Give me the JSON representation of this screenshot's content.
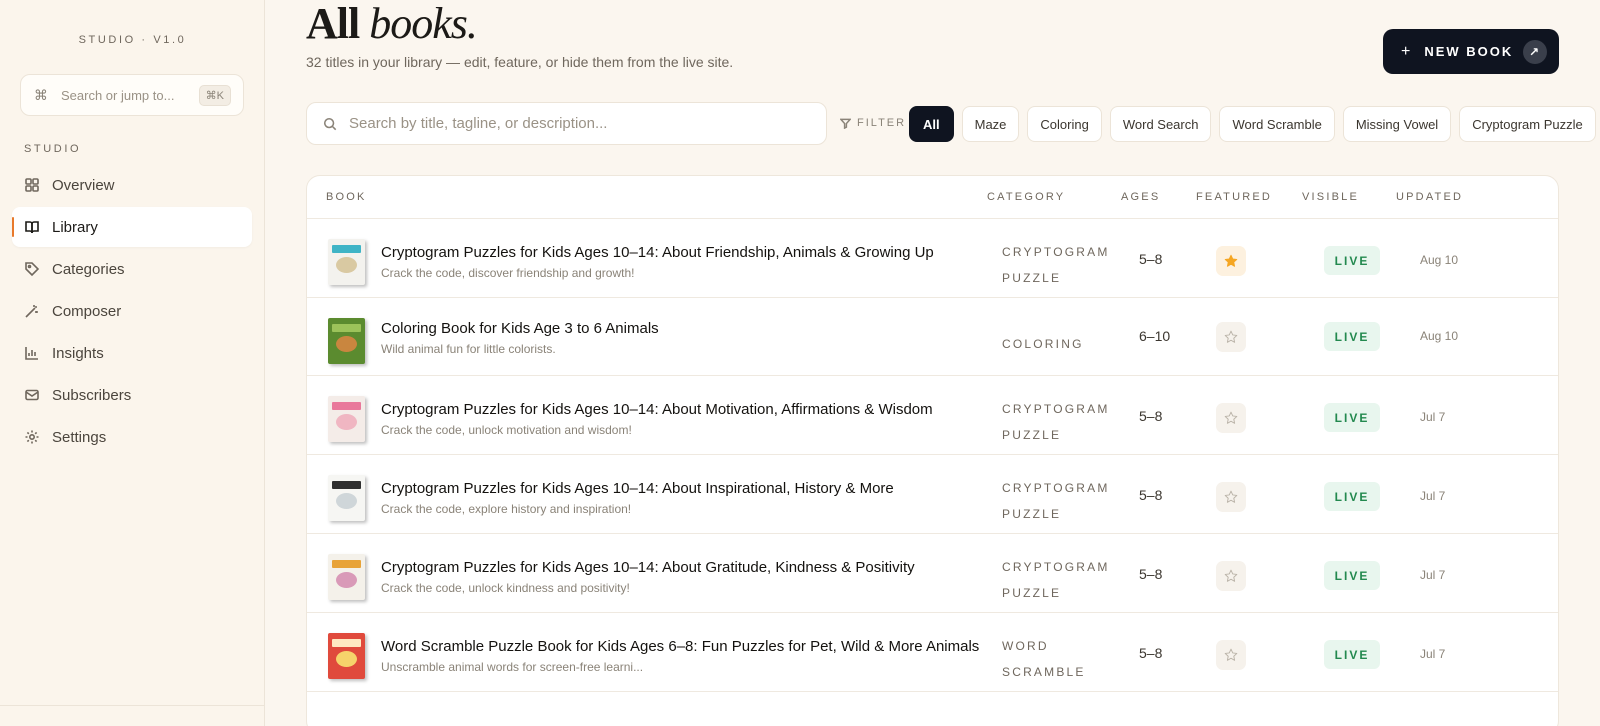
{
  "sidebar": {
    "brand": "STUDIO · V1.0",
    "jump": {
      "placeholder": "Search or jump to...",
      "shortcut": "⌘K",
      "icon": "command-icon"
    },
    "section_label": "STUDIO",
    "items": [
      {
        "label": "Overview",
        "icon": "grid-icon"
      },
      {
        "label": "Library",
        "icon": "open-book-icon",
        "active": true
      },
      {
        "label": "Categories",
        "icon": "tag-icon"
      },
      {
        "label": "Composer",
        "icon": "magic-wand-icon"
      },
      {
        "label": "Insights",
        "icon": "bar-chart-icon"
      },
      {
        "label": "Subscribers",
        "icon": "mail-icon"
      },
      {
        "label": "Settings",
        "icon": "gear-icon"
      }
    ],
    "accent": "#e8792b"
  },
  "header": {
    "title_bold": "All",
    "title_italic": "books.",
    "subtitle": "32 titles in your library — edit, feature, or hide them from the live site.",
    "new_button": "NEW BOOK"
  },
  "search": {
    "placeholder": "Search by title, tagline, or description...",
    "value": ""
  },
  "filter": {
    "label": "FILTER",
    "chips": [
      "All",
      "Maze",
      "Coloring",
      "Word Search",
      "Word Scramble",
      "Missing Vowel",
      "Cryptogram Puzzle"
    ],
    "active": "All"
  },
  "table": {
    "columns": {
      "book": "BOOK",
      "category": "CATEGORY",
      "ages": "AGES",
      "featured": "FEATURED",
      "visible": "VISIBLE",
      "updated": "UPDATED"
    },
    "rows": [
      {
        "title": "Cryptogram Puzzles for Kids Ages 10–14: About Friendship, Animals & Growing Up",
        "tagline": "Crack the code, discover friendship and growth!",
        "cat1": "CRYPTOGRAM",
        "cat2": "PUZZLE",
        "ages": "5–8",
        "featured": true,
        "visible": "LIVE",
        "updated": "Aug 10"
      },
      {
        "title": "Coloring Book for Kids Age 3 to 6 Animals",
        "tagline": "Wild animal fun for little colorists.",
        "cat1": "COLORING",
        "cat2": "",
        "ages": "6–10",
        "featured": false,
        "visible": "LIVE",
        "updated": "Aug 10"
      },
      {
        "title": "Cryptogram Puzzles for Kids Ages 10–14: About Motivation, Affirmations & Wisdom",
        "tagline": "Crack the code, unlock motivation and wisdom!",
        "cat1": "CRYPTOGRAM",
        "cat2": "PUZZLE",
        "ages": "5–8",
        "featured": false,
        "visible": "LIVE",
        "updated": "Jul 7"
      },
      {
        "title": "Cryptogram Puzzles for Kids Ages 10–14: About Inspirational, History & More",
        "tagline": "Crack the code, explore history and inspiration!",
        "cat1": "CRYPTOGRAM",
        "cat2": "PUZZLE",
        "ages": "5–8",
        "featured": false,
        "visible": "LIVE",
        "updated": "Jul 7"
      },
      {
        "title": "Cryptogram Puzzles for Kids Ages 10–14: About Gratitude, Kindness & Positivity",
        "tagline": "Crack the code, unlock kindness and positivity!",
        "cat1": "CRYPTOGRAM",
        "cat2": "PUZZLE",
        "ages": "5–8",
        "featured": false,
        "visible": "LIVE",
        "updated": "Jul 7"
      },
      {
        "title": "Word Scramble Puzzle Book for Kids Ages 6–8: Fun Puzzles for Pet, Wild & More Animals",
        "tagline": "Unscramble animal words for screen-free learni...",
        "cat1": "WORD",
        "cat2": "SCRAMBLE",
        "ages": "5–8",
        "featured": false,
        "visible": "LIVE",
        "updated": "Jul 7"
      }
    ]
  },
  "colors": {
    "primary_dark": "#0f1420",
    "live_green": "#23894f",
    "star_orange": "#f5a623"
  }
}
